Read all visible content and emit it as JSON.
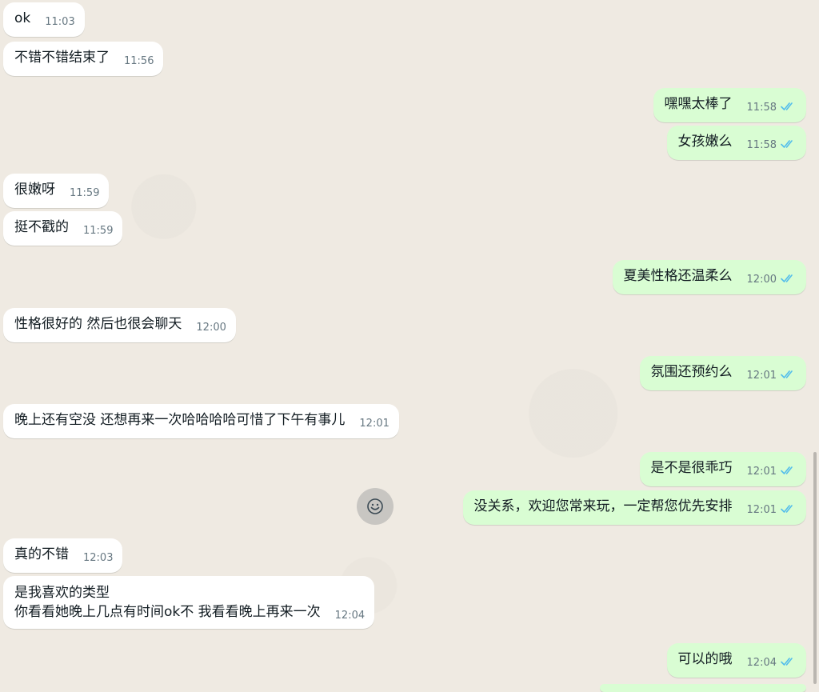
{
  "messages": [
    {
      "id": "m1",
      "text": "ok",
      "time": "11:03"
    },
    {
      "id": "m2",
      "text": "不错不错结束了",
      "time": "11:56"
    },
    {
      "id": "m3",
      "text": "嘿嘿太棒了",
      "time": "11:58"
    },
    {
      "id": "m4",
      "text": "女孩嫩么",
      "time": "11:58"
    },
    {
      "id": "m5",
      "text": "很嫩呀",
      "time": "11:59"
    },
    {
      "id": "m6",
      "text": "挺不戳的",
      "time": "11:59"
    },
    {
      "id": "m7",
      "text": "夏美性格还温柔么",
      "time": "12:00"
    },
    {
      "id": "m8",
      "text": "性格很好的 然后也很会聊天",
      "time": "12:00"
    },
    {
      "id": "m9",
      "text": "氛围还预约么",
      "time": "12:01"
    },
    {
      "id": "m10",
      "text": "晚上还有空没 还想再来一次哈哈哈哈可惜了下午有事儿",
      "time": "12:01"
    },
    {
      "id": "m11",
      "text": "是不是很乖巧",
      "time": "12:01"
    },
    {
      "id": "m12",
      "text": "没关系，欢迎您常来玩，一定帮您优先安排",
      "time": "12:01"
    },
    {
      "id": "m13",
      "text": "真的不错",
      "time": "12:03"
    },
    {
      "id": "m14",
      "text": "是我喜欢的类型\n你看看她晚上几点有时间ok不 我看看晚上再来一次",
      "time": "12:04"
    },
    {
      "id": "m15",
      "text": "可以的哦",
      "time": "12:04"
    }
  ],
  "icons": {
    "read_receipt": "double-check-icon",
    "emoji": "smiley-icon"
  },
  "colors": {
    "background": "#efeae2",
    "incoming_bubble": "#ffffff",
    "outgoing_bubble": "#d9fdd3",
    "read_tick": "#53bdeb",
    "timestamp": "#667781"
  }
}
